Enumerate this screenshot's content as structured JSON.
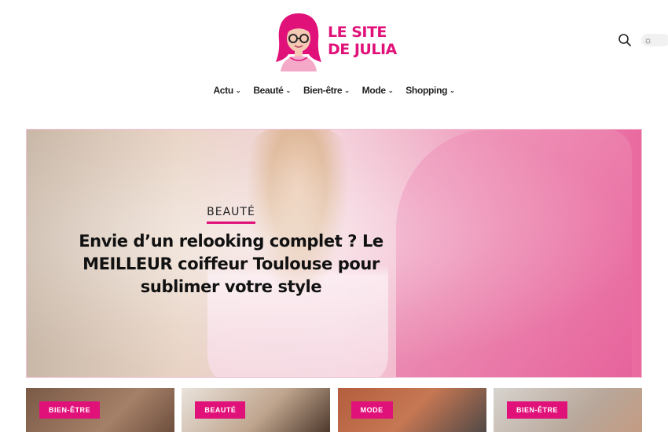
{
  "logo": {
    "line1": "LE SITE",
    "line2": "DE JULIA"
  },
  "header": {
    "search_icon": "search-icon",
    "theme_icon": "sun-icon"
  },
  "nav": {
    "items": [
      {
        "label": "Actu"
      },
      {
        "label": "Beauté"
      },
      {
        "label": "Bien-être"
      },
      {
        "label": "Mode"
      },
      {
        "label": "Shopping"
      }
    ]
  },
  "hero": {
    "category": "BEAUTÉ",
    "title_line1": "Envie d’un relooking complet ? Le",
    "title_line2": "MEILLEUR coiffeur Toulouse pour",
    "title_line3": "sublimer votre style"
  },
  "cards": [
    {
      "category": "BIEN-ÊTRE"
    },
    {
      "category": "BEAUTÉ"
    },
    {
      "category": "MODE"
    },
    {
      "category": "BIEN-ÊTRE"
    }
  ],
  "colors": {
    "accent": "#e0127a",
    "text": "#222222",
    "background": "#ffffff"
  }
}
